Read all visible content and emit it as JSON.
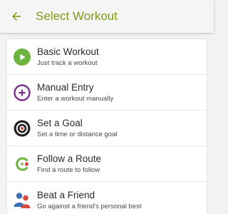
{
  "header": {
    "title": "Select Workout",
    "back_icon": "arrow-left-icon"
  },
  "colors": {
    "accent": "#7a9a1a",
    "basic": "#6cb33f",
    "manual": "#7b2d8e",
    "goal": "#222222",
    "route": "#6cb33f",
    "friend_a": "#3b6fb6",
    "friend_b": "#d94b3d"
  },
  "items": [
    {
      "title": "Basic Workout",
      "subtitle": "Just track a workout",
      "icon": "play-icon"
    },
    {
      "title": "Manual Entry",
      "subtitle": "Enter a workout manually",
      "icon": "plus-icon"
    },
    {
      "title": "Set a Goal",
      "subtitle": "Set a time or distance goal",
      "icon": "target-icon"
    },
    {
      "title": "Follow a Route",
      "subtitle": "Find a route to follow",
      "icon": "route-icon"
    },
    {
      "title": "Beat a Friend",
      "subtitle": "Go against a friend's personal best",
      "icon": "friends-icon"
    }
  ]
}
